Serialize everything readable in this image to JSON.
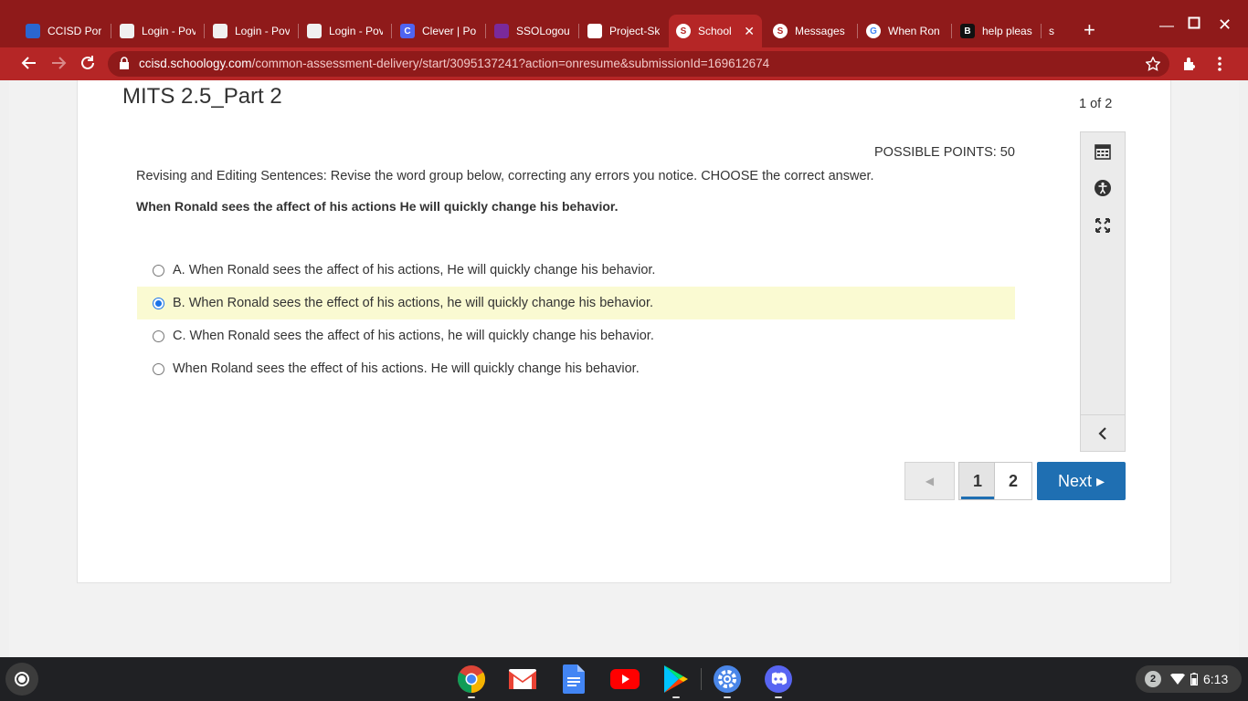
{
  "browser": {
    "tabs": [
      {
        "title": "CCISD Por",
        "favicon": "ccisd-icon"
      },
      {
        "title": "Login - Pov",
        "favicon": "powerschool-icon"
      },
      {
        "title": "Login - Pov",
        "favicon": "powerschool-icon"
      },
      {
        "title": "Login - Pov",
        "favicon": "powerschool-icon"
      },
      {
        "title": "Clever | Po",
        "favicon": "clever-icon",
        "favicon_letter": "C"
      },
      {
        "title": "SSOLogout",
        "favicon": "sso-icon"
      },
      {
        "title": "Project-Sk",
        "favicon": "globe-icon"
      },
      {
        "title": "School",
        "favicon": "schoology-icon",
        "favicon_letter": "S",
        "active": true
      },
      {
        "title": "Messages",
        "favicon": "schoology-icon",
        "favicon_letter": "S"
      },
      {
        "title": "When Ron",
        "favicon": "google-icon",
        "favicon_letter": "G"
      },
      {
        "title": "help please",
        "favicon": "brainly-icon",
        "favicon_letter": "B"
      },
      {
        "title": "sc",
        "favicon": "none"
      }
    ],
    "url_host": "ccisd.schoology.com",
    "url_path": "/common-assessment-delivery/start/3095137241?action=onresume&submissionId=169612674",
    "accent": "#b52626"
  },
  "assessment": {
    "title": "MITS 2.5_Part 2",
    "counter": "1 of 2",
    "points_label": "POSSIBLE POINTS: 50",
    "prompt": "Revising and Editing Sentences: Revise the word group below, correcting any errors you notice. CHOOSE the correct answer.",
    "stem": "When Ronald sees the affect of his actions He will quickly change his behavior.",
    "choices": [
      {
        "label": "A. When Ronald sees the affect of his actions, He will quickly change his behavior.",
        "selected": false
      },
      {
        "label": "B. When Ronald sees the effect of his actions, he will quickly change his behavior.",
        "selected": true
      },
      {
        "label": "C. When Ronald sees the affect of his actions, he will quickly change his behavior.",
        "selected": false
      },
      {
        "label": "When Roland sees the effect of his actions. He will quickly change his behavior.",
        "selected": false
      }
    ],
    "pager": {
      "prev": "◀",
      "pages": [
        "1",
        "2"
      ],
      "current": "1",
      "next_label": "Next ▸"
    }
  },
  "shelf": {
    "apps": [
      "chrome-icon",
      "gmail-icon",
      "docs-icon",
      "youtube-icon",
      "play-store-icon",
      "settings-icon",
      "discord-icon"
    ],
    "notification_count": "2",
    "time": "6:13"
  }
}
